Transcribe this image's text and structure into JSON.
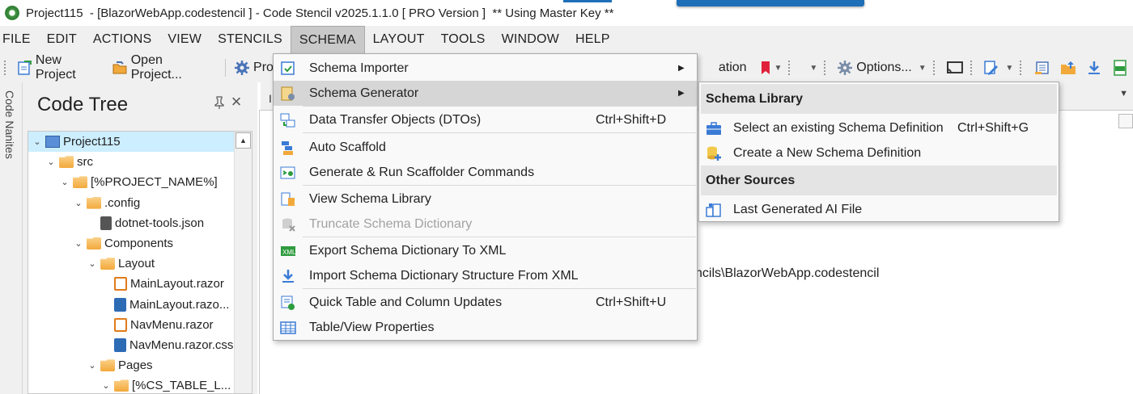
{
  "window": {
    "title": "Project115  - [BlazorWebApp.codestencil ] - Code Stencil v2025.1.1.0 [ PRO Version ]  ** Using Master Key **"
  },
  "menubar": {
    "items": [
      "FILE",
      "EDIT",
      "ACTIONS",
      "VIEW",
      "STENCILS",
      "SCHEMA",
      "LAYOUT",
      "TOOLS",
      "WINDOW",
      "HELP"
    ],
    "active": "SCHEMA"
  },
  "toolbar": {
    "new_project": "New Project",
    "open_project": "Open Project...",
    "truncated_left": "Pro",
    "truncated_right": "ation",
    "options": "Options..."
  },
  "side_strip": {
    "label": "Code Nanites"
  },
  "code_tree": {
    "title": "Code Tree",
    "pin_glyph": "📌",
    "close_glyph": "×",
    "nodes": [
      {
        "label": "Project115",
        "kind": "project",
        "indent": 0,
        "expanded": true,
        "selected": true
      },
      {
        "label": "src",
        "kind": "folder",
        "indent": 1,
        "expanded": true
      },
      {
        "label": "[%PROJECT_NAME%]",
        "kind": "folder",
        "indent": 2,
        "expanded": true
      },
      {
        "label": ".config",
        "kind": "folder",
        "indent": 3,
        "expanded": true
      },
      {
        "label": "dotnet-tools.json",
        "kind": "json",
        "indent": 4
      },
      {
        "label": "Components",
        "kind": "folder",
        "indent": 3,
        "expanded": true
      },
      {
        "label": "Layout",
        "kind": "folder",
        "indent": 4,
        "expanded": true
      },
      {
        "label": "MainLayout.razor",
        "kind": "razor",
        "indent": 5
      },
      {
        "label": "MainLayout.razo...",
        "kind": "css",
        "indent": 5
      },
      {
        "label": "NavMenu.razor",
        "kind": "razor",
        "indent": 5
      },
      {
        "label": "NavMenu.razor.css",
        "kind": "css",
        "indent": 5
      },
      {
        "label": "Pages",
        "kind": "folder",
        "indent": 4,
        "expanded": true
      },
      {
        "label": "[%CS_TABLE_L...",
        "kind": "folder",
        "indent": 5,
        "expanded": true
      }
    ]
  },
  "editor": {
    "tab_stub": "I",
    "path_fragment": "ncils\\BlazorWebApp.codestencil"
  },
  "schema_menu": {
    "items": [
      {
        "label": "Schema Importer",
        "shortcut": "",
        "submenu": true,
        "icon": "schema-importer-icon"
      },
      {
        "label": "Schema Generator",
        "shortcut": "",
        "submenu": true,
        "hover": true,
        "icon": "schema-generator-icon"
      },
      {
        "label": "Data Transfer Objects (DTOs)",
        "shortcut": "Ctrl+Shift+D",
        "icon": "dto-icon"
      },
      {
        "label": "Auto Scaffold",
        "shortcut": "",
        "icon": "auto-scaffold-icon"
      },
      {
        "label": "Generate & Run Scaffolder Commands",
        "shortcut": "",
        "icon": "scaffolder-commands-icon"
      },
      {
        "label": "View Schema Library",
        "shortcut": "",
        "icon": "schema-library-icon"
      },
      {
        "label": "Truncate Schema Dictionary",
        "shortcut": "",
        "disabled": true,
        "icon": "truncate-icon"
      },
      {
        "label": "Export Schema Dictionary To XML",
        "shortcut": "",
        "icon": "xml-export-icon"
      },
      {
        "label": "Import Schema Dictionary Structure From XML",
        "shortcut": "",
        "icon": "import-download-icon"
      },
      {
        "label": "Quick Table and Column Updates",
        "shortcut": "Ctrl+Shift+U",
        "icon": "quick-update-icon"
      },
      {
        "label": "Table/View Properties",
        "shortcut": "",
        "icon": "table-grid-icon"
      }
    ]
  },
  "schema_submenu": {
    "header_library": "Schema Library",
    "select_existing": "Select an existing Schema Definition",
    "select_existing_shortcut": "Ctrl+Shift+G",
    "create_new": "Create a New Schema Definition",
    "header_other": "Other Sources",
    "last_ai_file": "Last Generated AI File"
  },
  "colors": {
    "menubar_bg": "#f0f0f0",
    "menu_hover": "#d6d6d6",
    "tree_selected": "#cceeff",
    "accent_blue": "#1f6fb8"
  }
}
